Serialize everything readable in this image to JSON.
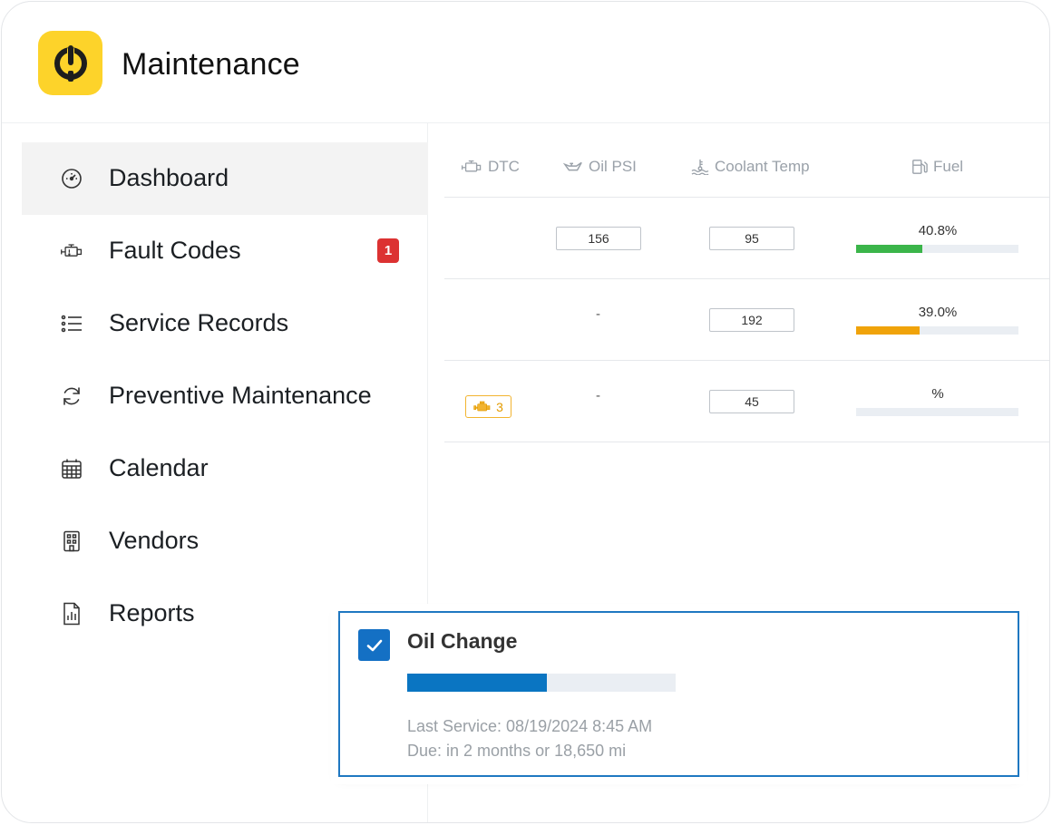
{
  "app": {
    "title": "Maintenance"
  },
  "sidebar": {
    "items": [
      {
        "label": "Dashboard",
        "icon": "gauge-icon",
        "active": true
      },
      {
        "label": "Fault Codes",
        "icon": "engine-icon",
        "badge": "1"
      },
      {
        "label": "Service Records",
        "icon": "list-icon"
      },
      {
        "label": "Preventive Maintenance",
        "icon": "refresh-icon"
      },
      {
        "label": "Calendar",
        "icon": "calendar-icon"
      },
      {
        "label": "Vendors",
        "icon": "building-icon"
      },
      {
        "label": "Reports",
        "icon": "report-icon"
      }
    ]
  },
  "table": {
    "columns": [
      {
        "label": "DTC",
        "icon": "engine-icon"
      },
      {
        "label": "Oil PSI",
        "icon": "oil-can-icon"
      },
      {
        "label": "Coolant Temp",
        "icon": "coolant-icon"
      },
      {
        "label": "Fuel",
        "icon": "fuel-pump-icon"
      }
    ],
    "rows": [
      {
        "dtc": "",
        "oil_psi": "156",
        "coolant": "95",
        "fuel_label": "40.8%",
        "fuel_level": 40.8,
        "fuel_color": "#3bb54a"
      },
      {
        "dtc": "",
        "oil_psi": "-",
        "coolant": "192",
        "fuel_label": "39.0%",
        "fuel_level": 39.0,
        "fuel_color": "#f0a30a"
      },
      {
        "dtc": "3",
        "oil_psi": "-",
        "coolant": "45",
        "fuel_label": "%",
        "fuel_level": 0,
        "fuel_color": "#3bb54a"
      }
    ]
  },
  "card": {
    "title": "Oil Change",
    "checked": true,
    "progress_percent": 52,
    "last_service": "Last Service: 08/19/2024 8:45 AM",
    "due": "Due: in 2 months or 18,650 mi"
  },
  "colors": {
    "logo": "#fdd32a",
    "badge": "#dc3232",
    "accent": "#1470c4",
    "dtc_warning": "#f2b430"
  }
}
